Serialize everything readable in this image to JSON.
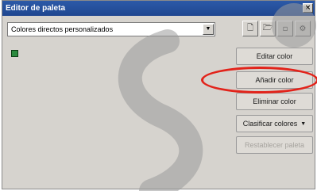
{
  "window": {
    "title": "Editor de paleta",
    "close_glyph": "×"
  },
  "palette_select": {
    "value": "Colores directos personalizados",
    "arrow_glyph": "▼"
  },
  "toolbar": {
    "icons": [
      "new-palette-icon",
      "open-palette-icon",
      "save-palette-icon",
      "palette-options-icon"
    ],
    "glyphs": [
      "🗋",
      "🗁",
      "▫",
      "⚙"
    ]
  },
  "swatches": [
    {
      "color": "#2b8a3e"
    }
  ],
  "actions": {
    "edit": "Editar color",
    "add": "Añadir color",
    "delete": "Eliminar color",
    "sort": "Clasificar colores",
    "sort_arrow": "▼",
    "reset": "Restablecer paleta"
  },
  "annotation": {
    "highlight_color": "#e2231a"
  },
  "watermark": {
    "color": "#9a9a9a"
  }
}
